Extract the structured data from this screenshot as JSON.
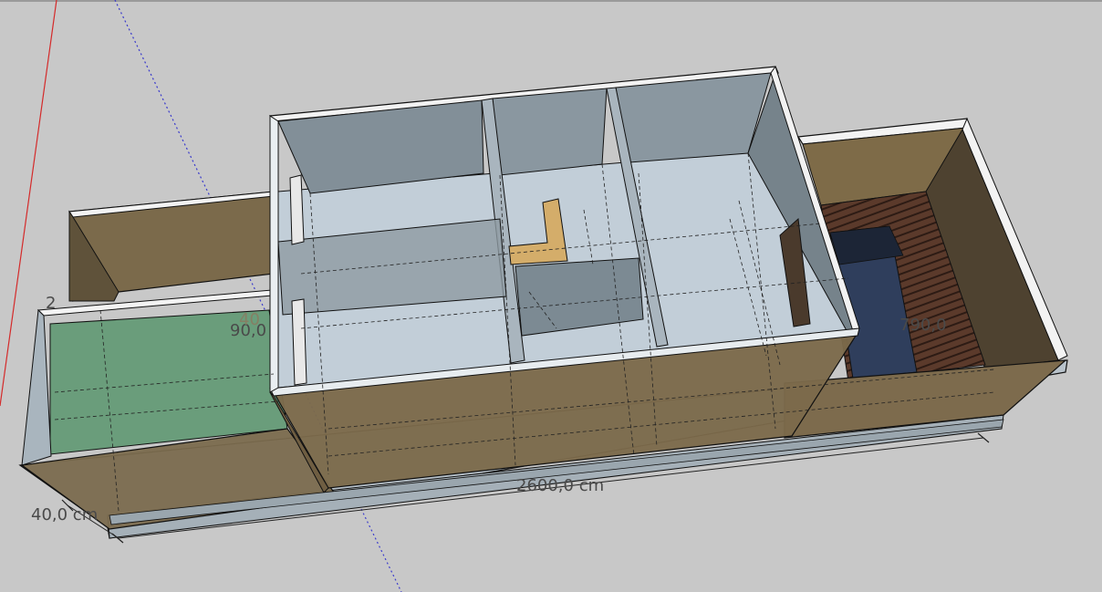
{
  "app": {
    "name": "3D modeling viewport"
  },
  "dimensions": {
    "length_label": "2600,0 cm",
    "height_label": "40,0 cm",
    "inner_width_label": "90,0",
    "right_width_label": "790,0",
    "partial_left_label": "2",
    "partial_faint_label": "40"
  },
  "colors": {
    "background": "#c8c8c8",
    "wall_glass": "#a7b4bf",
    "wall_dark": "#7f8c95",
    "floor_light": "#c4d0da",
    "wood": "#7a6a4c",
    "wood_dark": "#4d4130",
    "green_floor": "#6b9e7c",
    "pool_blue": "#2f3e5c",
    "deck": "#5a3a2a",
    "axis_red": "#d42a2a",
    "axis_blue": "#3a3acc",
    "edge": "#111111"
  }
}
